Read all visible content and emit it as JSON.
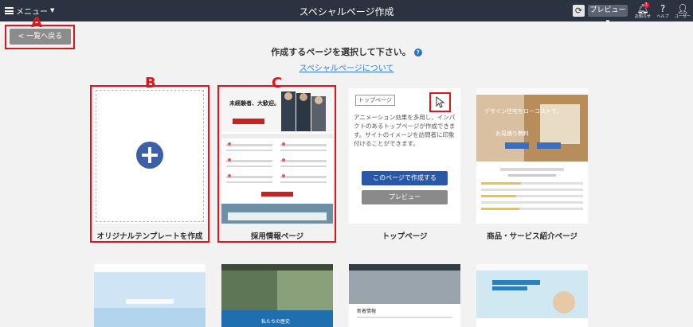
{
  "topbar": {
    "menu_label": "メニュー",
    "title": "スペシャルページ作成",
    "preview_label": "プレビュー",
    "tools": [
      {
        "icon": "bell-icon",
        "label": "お知らせ",
        "badge": "1"
      },
      {
        "icon": "help-icon",
        "label": "ヘルプ"
      },
      {
        "icon": "user-icon",
        "label": "ユーザー"
      }
    ]
  },
  "back_button": "< 一覧へ戻る",
  "heading": "作成するページを選択して下さい。",
  "about_link": "スペシャルページについて",
  "markers": {
    "a": "A",
    "b": "B",
    "c": "C"
  },
  "cards": [
    {
      "label": "オリジナルテンプレートを作成"
    },
    {
      "label": "採用情報ページ",
      "hero_text": "未経験者、大歓迎。"
    },
    {
      "label": "トップページ",
      "tag": "トップページ",
      "description": "アニメーション効果を多用し、インパクトのあるトップページが作成できます。サイトのイメージを訪問者に印象付けることができます。",
      "create_label": "このページで作成する",
      "preview_label": "プレビュー"
    },
    {
      "label": "商品・サービス紹介ページ",
      "hero_text": "デザイン住宅をローコストで。",
      "hero_text2": "お見積り無料"
    }
  ],
  "bottom_cards": [
    {
      "caption": ""
    },
    {
      "caption": "私たちの歴史"
    },
    {
      "caption": "新着情報"
    },
    {
      "caption": ""
    }
  ],
  "colors": {
    "accent": "#2a58a8",
    "marker": "#e0151b",
    "topbar": "#2b3340"
  }
}
